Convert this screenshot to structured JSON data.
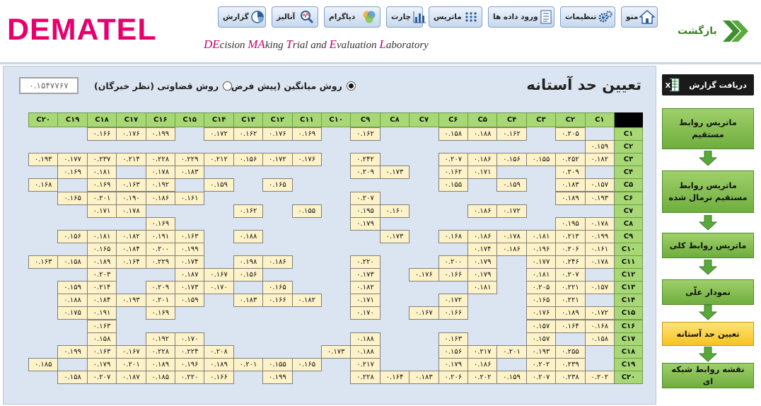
{
  "logo": "DEMATEL",
  "subtitle_parts": [
    {
      "t": "DE",
      "cap": true
    },
    {
      "t": "cision ",
      "cap": false
    },
    {
      "t": "MA",
      "cap": true
    },
    {
      "t": "king ",
      "cap": false
    },
    {
      "t": "T",
      "cap": true
    },
    {
      "t": "rial and ",
      "cap": false
    },
    {
      "t": "E",
      "cap": true
    },
    {
      "t": "valuation ",
      "cap": false
    },
    {
      "t": "L",
      "cap": true
    },
    {
      "t": "aboratory",
      "cap": false
    }
  ],
  "toolbar": [
    {
      "label": "منو",
      "icon": "home-icon"
    },
    {
      "label": "تنظیمات",
      "icon": "gears-icon"
    },
    {
      "label": "ورود داده ها",
      "icon": "checklist-icon"
    },
    {
      "label": "ماتریس",
      "icon": "matrix-dots-icon"
    },
    {
      "label": "چارت",
      "icon": "bar-chart-icon"
    },
    {
      "label": "دیاگرام",
      "icon": "venn-icon"
    },
    {
      "label": "آنالیز",
      "icon": "magnifier-icon"
    },
    {
      "label": "گزارش",
      "icon": "pie-chart-icon"
    }
  ],
  "back_label": "بازگشت",
  "page_title": "تعیین حد آستانه",
  "threshold_value": "۰.۱۵۴۷۷۶۷",
  "radio_mean_label": "روش میانگین (پیش فرض)",
  "radio_judge_label": "روش قضاوتی (نظر خبرگان)",
  "radio_selected": "mean",
  "columns": [
    "C۱",
    "C۲",
    "C۳",
    "C۴",
    "C۵",
    "C۶",
    "C۷",
    "C۸",
    "C۹",
    "C۱۰",
    "C۱۱",
    "C۱۲",
    "C۱۳",
    "C۱۴",
    "C۱۵",
    "C۱۶",
    "C۱۷",
    "C۱۸",
    "C۱۹",
    "C۲۰"
  ],
  "rows": [
    {
      "label": "C۱",
      "values": [
        "",
        "۰.۲۰۵",
        "",
        "۰.۱۶۲",
        "۰.۱۸۸",
        "۰.۱۵۸",
        "",
        "",
        "۰.۱۶۲",
        "",
        "۰.۱۶۹",
        "۰.۱۷۶",
        "۰.۱۶۲",
        "۰.۱۷۲",
        "",
        "۰.۱۹۹",
        "۰.۱۷۶",
        "۰.۱۶۶",
        "",
        ""
      ]
    },
    {
      "label": "C۲",
      "values": [
        "۰.۱۵۹",
        "",
        "",
        "",
        "",
        "",
        "",
        "",
        "",
        "",
        "",
        "",
        "",
        "",
        "",
        "",
        "",
        "",
        "",
        ""
      ]
    },
    {
      "label": "C۳",
      "values": [
        "۰.۱۸۲",
        "۰.۲۵۲",
        "۰.۱۵۵",
        "۰.۱۵۶",
        "۰.۱۸۶",
        "۰.۲۰۷",
        "",
        "",
        "۰.۲۴۲",
        "",
        "۰.۱۷۶",
        "۰.۱۷۲",
        "۰.۱۵۶",
        "۰.۲۱۲",
        "۰.۲۲۹",
        "۰.۲۲۸",
        "۰.۲۱۴",
        "۰.۲۳۷",
        "۰.۱۷۷",
        "۰.۱۹۳"
      ]
    },
    {
      "label": "C۴",
      "values": [
        "",
        "۰.۲۰۹",
        "",
        "",
        "۰.۱۷۱",
        "۰.۱۶۲",
        "",
        "۰.۱۷۳",
        "۰.۲۰۹",
        "",
        "",
        "",
        "",
        "",
        "۰.۱۸۳",
        "۰.۱۷۸",
        "",
        "۰.۱۸۱",
        "۰.۱۶۹",
        ""
      ]
    },
    {
      "label": "C۵",
      "values": [
        "۰.۱۵۷",
        "۰.۱۸۳",
        "",
        "۰.۱۵۹",
        "",
        "۰.۱۵۵",
        "",
        "",
        "",
        "",
        "",
        "۰.۱۶۵",
        "",
        "۰.۱۵۹",
        "",
        "۰.۱۹۲",
        "۰.۱۶۳",
        "۰.۱۶۹",
        "",
        "۰.۱۶۸"
      ]
    },
    {
      "label": "C۶",
      "values": [
        "۰.۱۹۳",
        "۰.۱۸۹",
        "",
        "",
        "",
        "",
        "",
        "",
        "۰.۲۰۷",
        "",
        "",
        "",
        "",
        "",
        "۰.۱۶۱",
        "۰.۱۸۶",
        "۰.۱۹۰",
        "۰.۲۰۱",
        "۰.۱۶۵",
        ""
      ]
    },
    {
      "label": "C۷",
      "values": [
        "",
        "",
        "",
        "۰.۱۷۲",
        "۰.۱۸۶",
        "",
        "",
        "۰.۱۶۰",
        "۰.۱۹۵",
        "",
        "۰.۱۵۵",
        "",
        "۰.۱۶۲",
        "",
        "",
        "",
        "۰.۱۷۸",
        "۰.۱۷۱",
        "",
        ""
      ]
    },
    {
      "label": "C۸",
      "values": [
        "۰.۱۷۸",
        "۰.۱۹۵",
        "",
        "",
        "",
        "",
        "",
        "",
        "۰.۱۷۹",
        "",
        "",
        "",
        "",
        "",
        "",
        "۰.۱۶۹",
        "",
        "",
        "",
        ""
      ]
    },
    {
      "label": "C۹",
      "values": [
        "۰.۱۹۹",
        "۰.۲۱۳",
        "۰.۱۸۱",
        "۰.۱۷۸",
        "۰.۱۸۶",
        "۰.۱۶۸",
        "",
        "۰.۱۷۳",
        "",
        "",
        "",
        "",
        "۰.۱۸۸",
        "",
        "۰.۱۶۳",
        "۰.۱۹۱",
        "۰.۱۸۲",
        "۰.۱۸۱",
        "۰.۱۵۶",
        ""
      ]
    },
    {
      "label": "C۱۰",
      "values": [
        "۰.۱۶۱",
        "۰.۲۰۶",
        "۰.۱۹۶",
        "۰.۱۸۶",
        "۰.۱۷۴",
        "",
        "",
        "",
        "",
        "",
        "",
        "",
        "",
        "",
        "۰.۱۹۹",
        "۰.۲۰۰",
        "۰.۱۸۴",
        "۰.۱۶۵",
        "",
        ""
      ]
    },
    {
      "label": "C۱۱",
      "values": [
        "۰.۱۷۸",
        "۰.۲۴۶",
        "۰.۱۷۷",
        "",
        "۰.۱۷۹",
        "۰.۲۰۰",
        "",
        "",
        "۰.۲۲۰",
        "",
        "",
        "۰.۱۸۶",
        "۰.۱۹۸",
        "",
        "۰.۱۷۴",
        "۰.۲۲۹",
        "۰.۱۶۴",
        "۰.۱۸۹",
        "۰.۱۵۸",
        "۰.۱۶۳"
      ]
    },
    {
      "label": "C۱۲",
      "values": [
        "",
        "۰.۲۰۷",
        "۰.۱۸۱",
        "",
        "۰.۱۷۹",
        "۰.۱۶۶",
        "۰.۱۷۶",
        "",
        "۰.۱۷۳",
        "",
        "",
        "",
        "۰.۱۵۶",
        "۰.۱۶۷",
        "۰.۱۸۷",
        "",
        "",
        "۰.۲۰۳",
        "",
        ""
      ]
    },
    {
      "label": "C۱۳",
      "values": [
        "۰.۱۵۷",
        "۰.۲۲۱",
        "۰.۲۰۵",
        "",
        "۰.۱۸۱",
        "",
        "",
        "",
        "۰.۱۸۲",
        "",
        "",
        "۰.۱۶۵",
        "",
        "۰.۱۷۰",
        "۰.۱۷۳",
        "۰.۲۰۹",
        "",
        "۰.۲۱۴",
        "۰.۱۵۹",
        ""
      ]
    },
    {
      "label": "C۱۴",
      "values": [
        "",
        "۰.۲۲۱",
        "۰.۱۶۵",
        "",
        "",
        "۰.۱۷۲",
        "",
        "",
        "۰.۱۷۱",
        "",
        "۰.۱۸۲",
        "۰.۱۶۶",
        "۰.۱۸۳",
        "",
        "۰.۱۵۹",
        "۰.۲۰۱",
        "۰.۱۹۳",
        "۰.۱۸۴",
        "۰.۱۸۸",
        ""
      ]
    },
    {
      "label": "C۱۵",
      "values": [
        "۰.۱۷۲",
        "۰.۱۸۹",
        "۰.۱۷۶",
        "",
        "",
        "۰.۱۶۶",
        "۰.۱۶۷",
        "",
        "۰.۱۷۰",
        "",
        "",
        "",
        "",
        "",
        "",
        "۰.۱۶۹",
        "",
        "۰.۱۹۱",
        "۰.۱۷۵",
        ""
      ]
    },
    {
      "label": "C۱۶",
      "values": [
        "۰.۱۶۸",
        "۰.۱۶۴",
        "۰.۱۵۷",
        "",
        "",
        "",
        "",
        "",
        "",
        "",
        "",
        "",
        "",
        "",
        "",
        "",
        "",
        "۰.۱۶۳",
        "",
        ""
      ]
    },
    {
      "label": "C۱۷",
      "values": [
        "۰.۱۵۸",
        "",
        "۰.۱۵۷",
        "",
        "",
        "۰.۱۶۳",
        "",
        "",
        "۰.۱۸۸",
        "",
        "",
        "",
        "",
        "",
        "۰.۱۷۰",
        "۰.۱۹۲",
        "",
        "۰.۱۵۸",
        "",
        ""
      ]
    },
    {
      "label": "C۱۸",
      "values": [
        "",
        "۰.۲۵۵",
        "۰.۱۹۳",
        "۰.۲۰۱",
        "۰.۲۱۷",
        "۰.۱۵۶",
        "",
        "",
        "۰.۱۸۸",
        "۰.۱۷۳",
        "",
        "",
        "",
        "۰.۲۰۸",
        "۰.۲۲۴",
        "۰.۲۲۸",
        "۰.۱۶۷",
        "۰.۱۶۳",
        "۰.۱۹۹",
        ""
      ]
    },
    {
      "label": "C۱۹",
      "values": [
        "",
        "۰.۲۳۹",
        "۰.۲۰۲",
        "",
        "۰.۱۸۶",
        "۰.۱۷۹",
        "",
        "",
        "۰.۲۱۷",
        "",
        "۰.۱۶۵",
        "۰.۱۵۵",
        "۰.۲۰۱",
        "۰.۱۸۹",
        "۰.۱۹۶",
        "۰.۱۸۹",
        "۰.۲۰۱",
        "۰.۱۷۹",
        "",
        "۰.۱۸۵"
      ]
    },
    {
      "label": "C۲۰",
      "values": [
        "۰.۲۰۲",
        "۰.۲۳۸",
        "۰.۲۰۷",
        "۰.۱۵۹",
        "۰.۲۰۲",
        "۰.۲۰۶",
        "۰.۱۸۳",
        "۰.۱۶۴",
        "۰.۲۲۸",
        "",
        "",
        "۰.۱۹۹",
        "",
        "۰.۱۶۶",
        "۰.۲۲۰",
        "۰.۱۸۵",
        "۰.۱۸۷",
        "۰.۲۰۷",
        "۰.۱۵۸",
        ""
      ]
    }
  ],
  "report_button": "دریافت گزارش",
  "nav": [
    {
      "label": "ماتریس روابط مستقیم",
      "active": false
    },
    {
      "label": "ماتریس روابط مستقیم نرمال شده",
      "active": false
    },
    {
      "label": "ماتریس روابط کلی",
      "active": false
    },
    {
      "label": "نمودار علّی",
      "active": false
    },
    {
      "label": "تعیین حد آستانه",
      "active": true
    },
    {
      "label": "نقشه روابط شبکه ای",
      "active": false
    }
  ],
  "colors": {
    "logo": "#e6006e",
    "header_cell": "#a8d876",
    "value_cell": "#fdf2c8",
    "nav_active": "#f5c422",
    "nav": "#7cbb47"
  }
}
